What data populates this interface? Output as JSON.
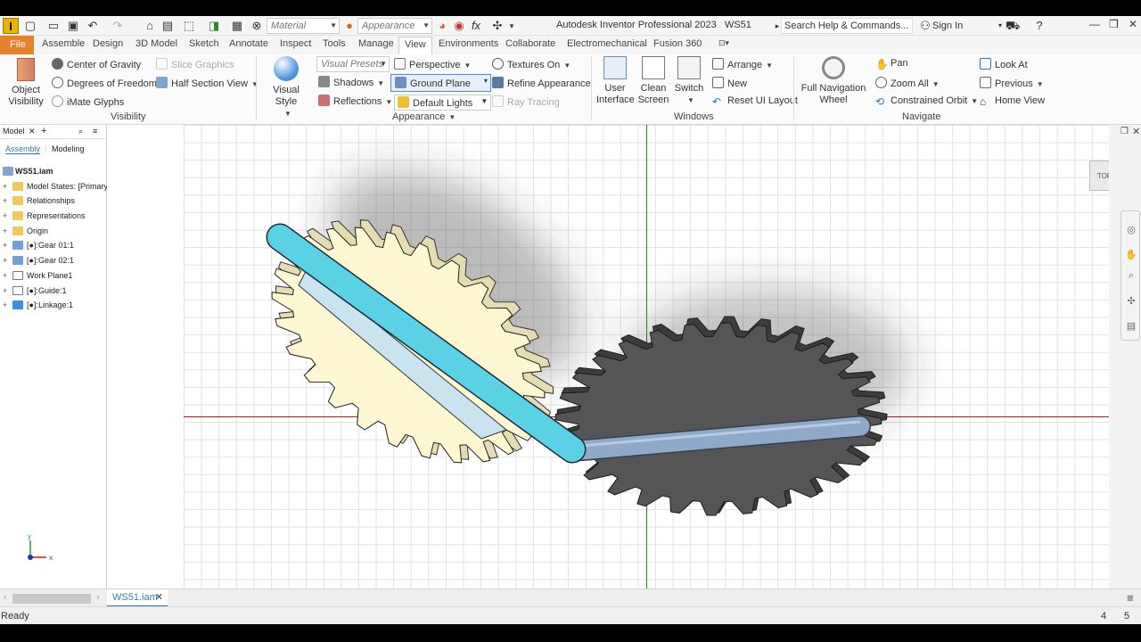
{
  "app": {
    "title": "Autodesk Inventor Professional 2023",
    "document": "WS51",
    "logo": "I"
  },
  "quick_access": {
    "material": "Material",
    "appearance": "Appearance",
    "search": "Search Help & Commands...",
    "sign_in": "Sign In"
  },
  "menu": {
    "items": [
      "File",
      "Assemble",
      "Design",
      "3D Model",
      "Sketch",
      "Annotate",
      "Inspect",
      "Tools",
      "Manage",
      "View",
      "Environments",
      "Collaborate",
      "Electromechanical",
      "Fusion 360"
    ],
    "active": "View"
  },
  "ribbon": {
    "visibility": {
      "object_visibility": "Object Visibility",
      "center_of_gravity": "Center of Gravity",
      "degrees_of_freedom": "Degrees of Freedom",
      "imate_glyphs": "iMate Glyphs",
      "slice_graphics": "Slice Graphics",
      "half_section_view": "Half Section View",
      "panel": "Visibility"
    },
    "appearance": {
      "visual_style": "Visual Style",
      "visual_presets": "Visual Presets",
      "shadows": "Shadows",
      "reflections": "Reflections",
      "perspective": "Perspective",
      "ground_plane": "Ground Plane",
      "default_lights": "Default Lights",
      "textures_on": "Textures On",
      "refine_appearance": "Refine Appearance",
      "ray_tracing": "Ray Tracing",
      "panel": "Appearance"
    },
    "windows": {
      "user_interface": "User Interface",
      "clean_screen": "Clean Screen",
      "switch": "Switch",
      "arrange": "Arrange",
      "new": "New",
      "reset_ui_layout": "Reset UI Layout",
      "panel": "Windows"
    },
    "navigate": {
      "full_navigation_wheel": "Full Navigation Wheel",
      "pan": "Pan",
      "zoom_all": "Zoom All",
      "constrained_orbit": "Constrained Orbit",
      "look_at": "Look At",
      "previous": "Previous",
      "home_view": "Home View",
      "panel": "Navigate"
    }
  },
  "browser": {
    "title": "Model",
    "tabs": [
      "Assembly",
      "Modeling"
    ],
    "root": "WS51.iam",
    "nodes": [
      "Model States: [Primary]",
      "Relationships",
      "Representations",
      "Origin",
      "[●]:Gear 01:1",
      "[●]:Gear 02:1",
      "Work Plane1",
      "[●]:Guide:1",
      "[●]:Linkage:1"
    ]
  },
  "viewcube": {
    "face": "TOP"
  },
  "axes": {
    "x": "x",
    "y": "y"
  },
  "doc_tab": {
    "label": "WS51.iam"
  },
  "status": {
    "text": "Ready",
    "n1": "4",
    "n2": "5"
  },
  "colors": {
    "file_tab": "#e8822a",
    "gear1": "#fdf8d2",
    "gear2": "#555555",
    "linkage": "#5bd1e6",
    "guide": "#8fa9c9"
  }
}
